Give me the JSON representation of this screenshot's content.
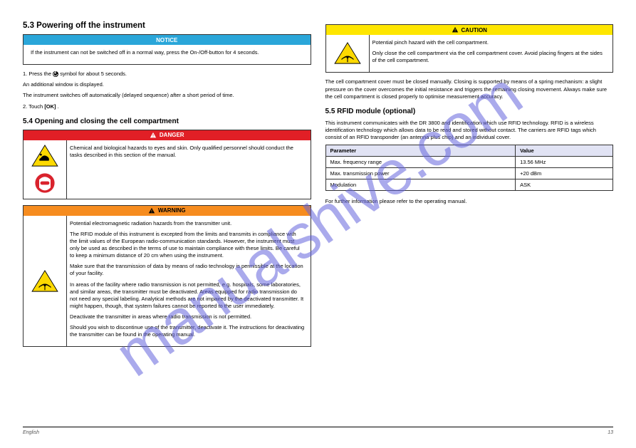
{
  "left": {
    "title": "5.3  Powering off the instrument",
    "notice": {
      "banner": "NOTICE",
      "p1": "If the instrument can not be switched off in a normal way, press the On-/Off-button for 4 seconds.",
      "p2_a": "1. Press the ",
      "p2_b": " symbol for about 5 seconds.",
      "p3": "An additional window is displayed.",
      "p4": "The instrument switches off automatically (delayed sequence) after a short period of time.",
      "p5_a": "2. Touch ",
      "p5_b": "[OK]",
      "p5_c": "."
    },
    "h2": "5.4  Opening and closing the cell compartment",
    "danger": {
      "banner": "DANGER",
      "body": "Chemical and biological hazards to eyes and skin. Only qualified personnel should conduct the tasks described in this section of the manual."
    },
    "warning": {
      "banner": "WARNING",
      "p1": "Potential electromagnetic radiation hazards from the transmitter unit.",
      "p2": "The RFID module of this instrument is excepted from the limits and transmits in compliance with the limit values of the European radio-communication standards. However, the instrument must only be used as described in the terms of use to maintain compliance with these limits. Be careful to keep a minimum distance of 20 cm when using the instrument.",
      "p3": "Make sure that the transmission of data by means of radio technology is permissible at the location of your facility.",
      "p4": "In areas of the facility where radio transmission is not permitted, e.g. hospitals, some laboratories, and similar areas, the transmitter must be deactivated. Areas equipped for radio transmission do not need any special labeling. Analytical methods are not impaired by the deactivated transmitter. It might happen, though, that system failures cannot be reported to the user immediately.",
      "p5": "Deactivate the transmitter in areas where radio transmission is not permitted.",
      "p6": "Should you wish to discontinue use of the transmitter, deactivate it. The instructions for deactivating the transmitter can be found in the operating manual."
    }
  },
  "right": {
    "caution": {
      "banner": "CAUTION",
      "p1": "Potential pinch hazard with the cell compartment.",
      "p2": "Only close the cell compartment via the cell compartment cover. Avoid placing fingers at the sides of the cell compartment."
    },
    "para1": "The cell compartment cover must be closed manually. Closing is supported by means of a spring mechanism: a slight pressure on the cover overcomes the initial resistance and triggers the remaining closing movement. Always make sure the cell compartment is closed properly to optimise measurement accuracy.",
    "para2": "This instrument communicates with the DR 3800 and identification which use RFID technology. RFID is a wireless identification technology which allows data to be read and stored without contact. The carriers are RFID tags which consist of an RFID transponder (an antenna plus chip) and an individual cover.",
    "h2": "5.5  RFID module (optional)",
    "table": {
      "h1": "Parameter",
      "h2": "Value",
      "r1c1": "Max. frequency range",
      "r1c2": "13.56 MHz",
      "r2c1": "Max. transmission power",
      "r2c2": "+20 dBm",
      "r3c1": "Modulation",
      "r3c2": "ASK"
    },
    "para3": "For further information please refer to the operating manual."
  },
  "footer": {
    "left": "English",
    "right": "13"
  },
  "watermark": "manualshive.com"
}
